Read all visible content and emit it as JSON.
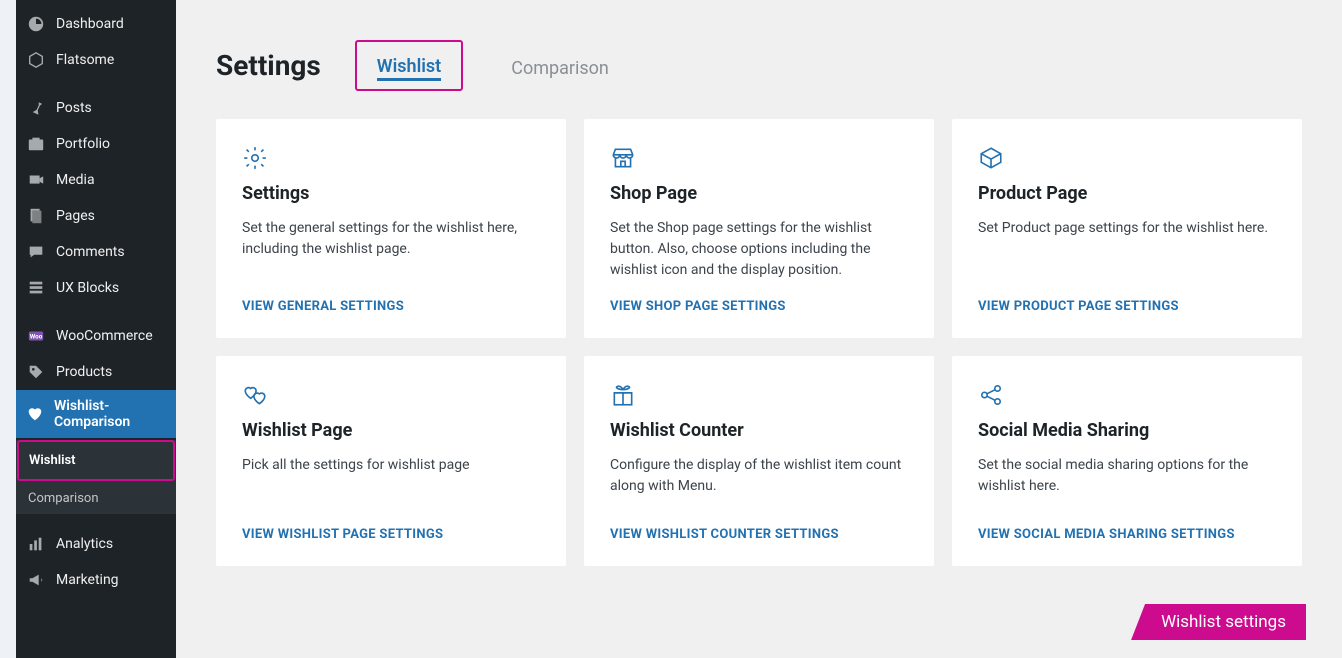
{
  "page_title": "Settings",
  "tabs": [
    {
      "label": "Wishlist"
    },
    {
      "label": "Comparison"
    }
  ],
  "sidebar": {
    "group1": [
      {
        "label": "Dashboard"
      },
      {
        "label": "Flatsome"
      }
    ],
    "group2": [
      {
        "label": "Posts"
      },
      {
        "label": "Portfolio"
      },
      {
        "label": "Media"
      },
      {
        "label": "Pages"
      },
      {
        "label": "Comments"
      },
      {
        "label": "UX Blocks"
      }
    ],
    "group3": [
      {
        "label": "WooCommerce"
      },
      {
        "label": "Products"
      },
      {
        "label": "Wishlist-Comparison"
      }
    ],
    "submenu": [
      {
        "label": "Wishlist"
      },
      {
        "label": "Comparison"
      }
    ],
    "group4": [
      {
        "label": "Analytics"
      },
      {
        "label": "Marketing"
      }
    ]
  },
  "cards": [
    {
      "title": "Settings",
      "desc": "Set the general settings for the wishlist here, including the wishlist page.",
      "link": "VIEW GENERAL SETTINGS"
    },
    {
      "title": "Shop Page",
      "desc": "Set the Shop page settings for the wishlist button. Also, choose options including the wishlist icon and the display position.",
      "link": "VIEW SHOP PAGE SETTINGS"
    },
    {
      "title": "Product Page",
      "desc": "Set Product page settings for the wishlist here.",
      "link": "VIEW PRODUCT PAGE SETTINGS"
    },
    {
      "title": "Wishlist Page",
      "desc": "Pick all the settings for wishlist page",
      "link": "VIEW WISHLIST PAGE SETTINGS"
    },
    {
      "title": "Wishlist Counter",
      "desc": "Configure the display of the wishlist item count along with Menu.",
      "link": "VIEW WISHLIST COUNTER SETTINGS"
    },
    {
      "title": "Social Media Sharing",
      "desc": "Set the social media sharing options for the wishlist here.",
      "link": "VIEW SOCIAL MEDIA SHARING SETTINGS"
    }
  ],
  "badge": "Wishlist settings"
}
